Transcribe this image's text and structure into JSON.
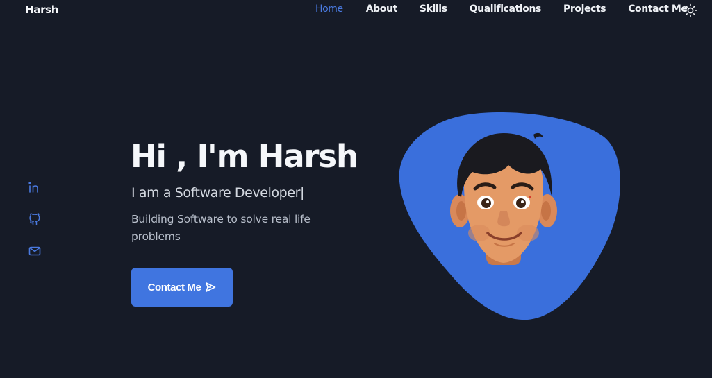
{
  "header": {
    "logo": "Harsh",
    "nav": [
      {
        "label": "Home",
        "active": true
      },
      {
        "label": "About",
        "active": false
      },
      {
        "label": "Skills",
        "active": false
      },
      {
        "label": "Qualifications",
        "active": false
      },
      {
        "label": "Projects",
        "active": false
      },
      {
        "label": "Contact Me",
        "active": false
      }
    ],
    "theme_toggle_icon": "sun-icon"
  },
  "social": [
    {
      "name": "linkedin",
      "icon": "linkedin-icon"
    },
    {
      "name": "github",
      "icon": "github-icon"
    },
    {
      "name": "email",
      "icon": "mail-icon"
    }
  ],
  "hero": {
    "title": "Hi , I'm Harsh",
    "subtitle": "I am a Software Developer",
    "subtitle_caret": "|",
    "description": "Building Software to solve real life problems",
    "button_label": "Contact Me",
    "button_icon": "send-icon"
  },
  "colors": {
    "background": "#161b27",
    "accent": "#4075e0",
    "text": "#f5f7fa"
  }
}
